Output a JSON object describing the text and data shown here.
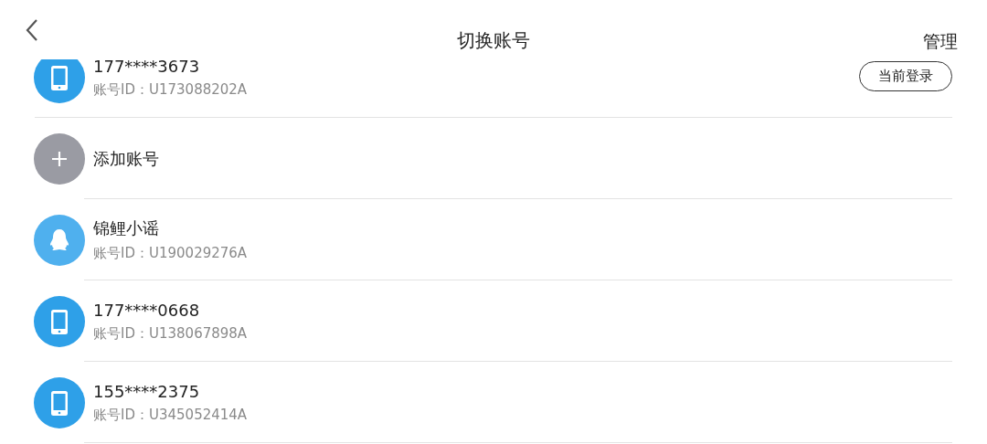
{
  "header": {
    "title": "切换账号",
    "action": "管理"
  },
  "accounts": [
    {
      "kind": "phone",
      "name": "177****3673",
      "account_id": "账号ID：U173088202A",
      "badge": "当前登录"
    },
    {
      "kind": "add",
      "name": "添加账号"
    },
    {
      "kind": "qq",
      "name": "锦鲤小谣",
      "account_id": "账号ID：U190029276A"
    },
    {
      "kind": "phone",
      "name": "177****0668",
      "account_id": "账号ID：U138067898A"
    },
    {
      "kind": "phone",
      "name": "155****2375",
      "account_id": "账号ID：U345052414A"
    }
  ]
}
